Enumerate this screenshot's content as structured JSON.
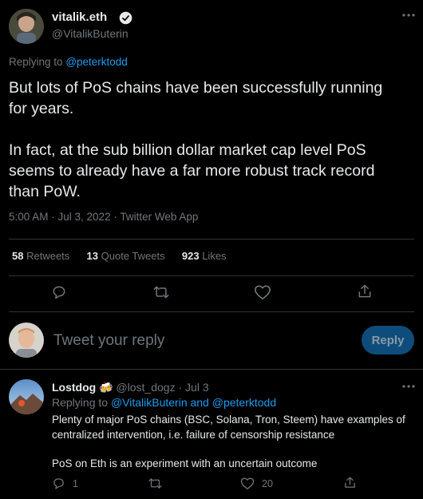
{
  "tweet": {
    "author_name": "vitalik.eth",
    "author_handle": "@VitalikButerin",
    "replying_prefix": "Replying to",
    "replying_handle": "@peterktodd",
    "para1_line1": "But lots of PoS chains have been successfully running",
    "para1_line2": "for years.",
    "para2_line1": "In fact, at the sub billion dollar market cap level PoS",
    "para2_line2": "seems to already have a far more robust track record",
    "para2_line3": "than PoW.",
    "meta": "5:00 AM · Jul 3, 2022 · Twitter Web App",
    "stats": {
      "retweets_count": "58",
      "retweets_label": "Retweets",
      "quote_count": "13",
      "quote_label": "Quote Tweets",
      "likes_count": "923",
      "likes_label": "Likes"
    },
    "more_icon": "more-horizontal-icon"
  },
  "compose": {
    "placeholder": "Tweet your reply",
    "reply_label": "Reply"
  },
  "reply": {
    "author_name": "Lostdog",
    "emoji": "🍻",
    "author_handle": "@lost_dogz",
    "date": "· Jul 3",
    "replying_prefix": "Replying to",
    "replying_handles": "@VitalikButerin and @peterktodd",
    "line1": "Plenty of major PoS chains (BSC, Solana, Tron, Steem) have examples of",
    "line2": "centralized intervention, i.e. failure of censorship resistance",
    "line3": "PoS on Eth is an experiment with an uncertain outcome",
    "reply_count": "1",
    "like_count": "20"
  },
  "colors": {
    "background": "#000000",
    "accent": "#1d9bf0",
    "text": "#e7e9ea",
    "muted": "#71767b"
  }
}
